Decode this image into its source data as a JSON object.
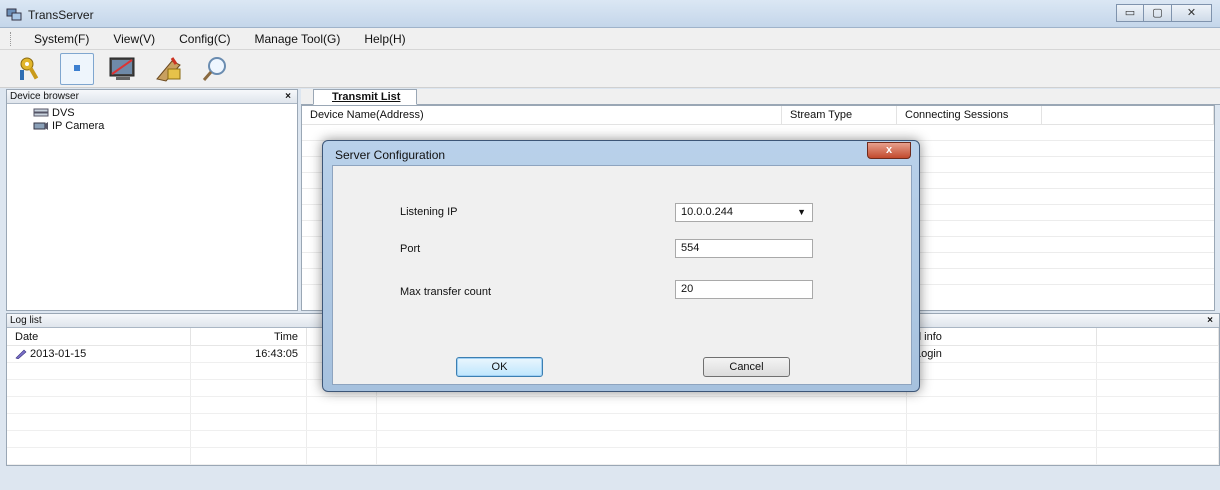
{
  "window": {
    "title": "TransServer",
    "min": "▭",
    "max": "▢",
    "close": "✕"
  },
  "menu": [
    "System(F)",
    "View(V)",
    "Config(C)",
    "Manage Tool(G)",
    "Help(H)"
  ],
  "toolbar": {
    "icons": [
      "key-icon",
      "device-icon",
      "monitor-icon",
      "config-icon",
      "search-icon"
    ]
  },
  "device_browser": {
    "title": "Device browser",
    "close": "×",
    "items": [
      "DVS",
      "IP Camera"
    ]
  },
  "transmit": {
    "tab": "Transmit List",
    "columns": [
      "Device Name(Address)",
      "Stream Type",
      "Connecting Sessions",
      ""
    ]
  },
  "log": {
    "title": "Log list",
    "close": "×",
    "columns": [
      "Date",
      "Time",
      "",
      "",
      "d info",
      ""
    ],
    "rows": [
      {
        "date": "2013-01-15",
        "time": "16:43:05",
        "info": "Login"
      }
    ]
  },
  "dialog": {
    "title": "Server Configuration",
    "close": "x",
    "listening_ip_label": "Listening IP",
    "listening_ip_value": "10.0.0.244",
    "port_label": "Port",
    "port_value": "554",
    "max_label": "Max transfer count",
    "max_value": "20",
    "ok": "OK",
    "cancel": "Cancel"
  }
}
